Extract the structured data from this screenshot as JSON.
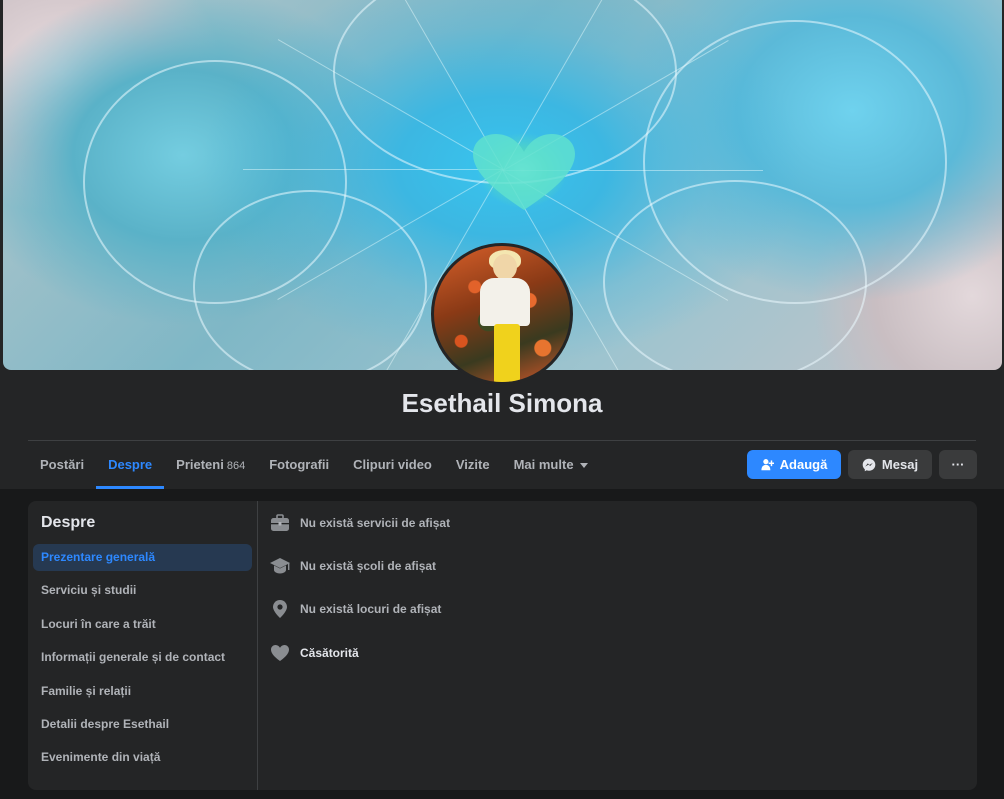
{
  "profile": {
    "name": "Esethail Simona"
  },
  "tabs": [
    {
      "label": "Postări"
    },
    {
      "label": "Despre"
    },
    {
      "label": "Prieteni",
      "count": "864"
    },
    {
      "label": "Fotografii"
    },
    {
      "label": "Clipuri video"
    },
    {
      "label": "Vizite"
    },
    {
      "label": "Mai multe"
    }
  ],
  "actions": {
    "add_label": "Adaugă",
    "message_label": "Mesaj",
    "more_label": "···"
  },
  "about": {
    "title": "Despre",
    "menu": [
      {
        "label": "Prezentare generală",
        "active": true
      },
      {
        "label": "Serviciu și studii"
      },
      {
        "label": "Locuri în care a trăit"
      },
      {
        "label": "Informații generale și de contact"
      },
      {
        "label": "Familie și relații"
      },
      {
        "label": "Detalii despre Esethail"
      },
      {
        "label": "Evenimente din viață"
      }
    ],
    "overview": [
      {
        "icon": "briefcase-icon",
        "text": "Nu există servicii de afișat"
      },
      {
        "icon": "graduation-cap-icon",
        "text": "Nu există școli de afișat"
      },
      {
        "icon": "location-pin-icon",
        "text": "Nu există locuri de afișat"
      },
      {
        "icon": "heart-icon",
        "text": "Căsătorită"
      }
    ]
  },
  "colors": {
    "accent": "#2d88ff",
    "background": "#18191a",
    "surface": "#242526"
  }
}
